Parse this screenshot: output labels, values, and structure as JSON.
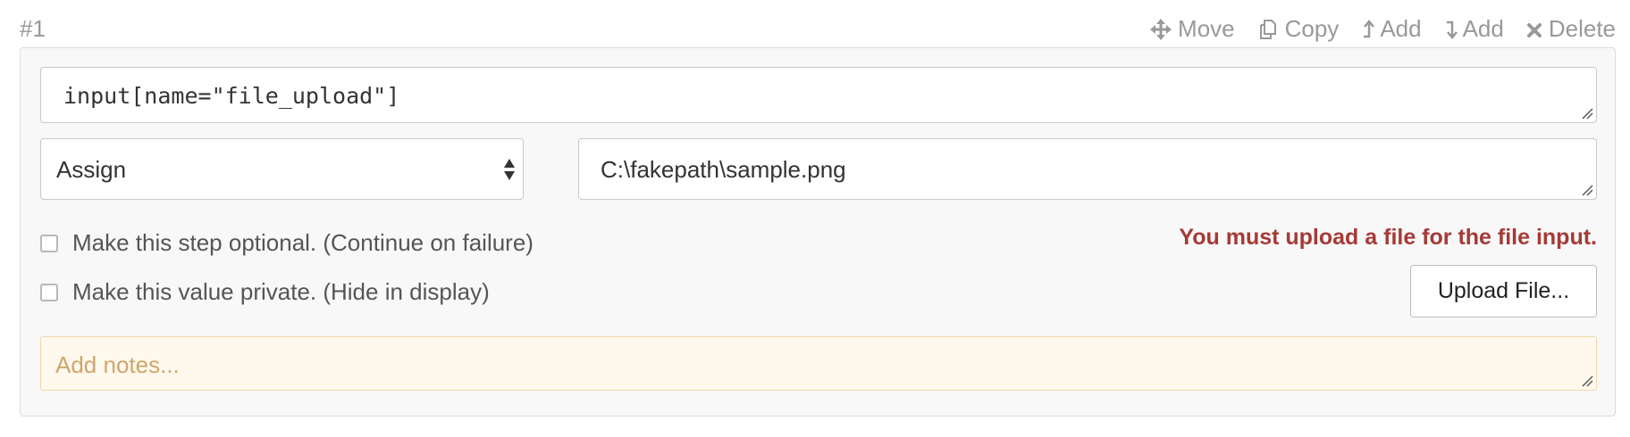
{
  "step": {
    "number": "#1"
  },
  "actions": [
    {
      "label": "Move",
      "icon": "move-icon"
    },
    {
      "label": "Copy",
      "icon": "copy-icon"
    },
    {
      "label": "Add",
      "icon": "add-above-icon"
    },
    {
      "label": "Add",
      "icon": "add-below-icon"
    },
    {
      "label": "Delete",
      "icon": "delete-icon"
    }
  ],
  "selector": {
    "value": "input[name=\"file_upload\"]"
  },
  "action_select": {
    "selected": "Assign"
  },
  "value_field": {
    "value": "C:\\fakepath\\sample.png"
  },
  "options": {
    "optional_label": "Make this step optional. (Continue on failure)",
    "private_label": "Make this value private. (Hide in display)"
  },
  "error": {
    "message": "You must upload a file for the file input."
  },
  "upload": {
    "button_label": "Upload File..."
  },
  "notes": {
    "placeholder": "Add notes..."
  },
  "colors": {
    "error": "#a53a36",
    "notes_bg": "#fff8ec",
    "muted": "#999999"
  }
}
